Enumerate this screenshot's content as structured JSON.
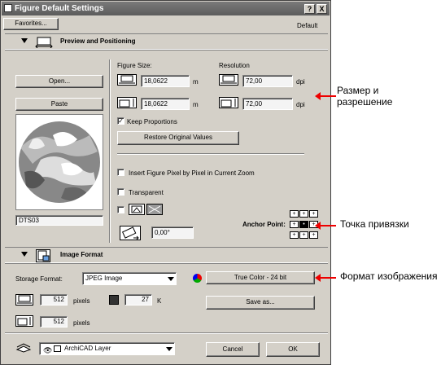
{
  "window": {
    "title": "Figure Default Settings",
    "help_label": "?",
    "close_label": "X"
  },
  "toolbar": {
    "favorites_label": "Favorites...",
    "default_label": "Default"
  },
  "preview_section": {
    "title": "Preview and Positioning"
  },
  "buttons": {
    "open_label": "Open...",
    "paste_label": "Paste",
    "restore_label": "Restore Original Values"
  },
  "filename": "DTS03",
  "size": {
    "label": "Figure Size:",
    "width": "18,0622",
    "height": "18,0622",
    "unit": "m"
  },
  "resolution": {
    "label": "Resolution",
    "horizontal": "72,00",
    "vertical": "72,00",
    "unit": "dpi"
  },
  "options": {
    "keep_proportions": "Keep Proportions",
    "keep_proportions_checked": true,
    "insert_pixel": "Insert Figure Pixel by Pixel in Current Zoom",
    "insert_pixel_checked": false,
    "transparent": "Transparent",
    "transparent_checked": false,
    "mirror_checked": false
  },
  "rotation": {
    "value": "0,00°"
  },
  "anchor": {
    "label": "Anchor Point:"
  },
  "image_format_section": {
    "title": "Image Format"
  },
  "format": {
    "storage_label": "Storage Format:",
    "storage_value": "JPEG Image",
    "color_depth": "True Color - 24 bit",
    "save_as_label": "Save as...",
    "width_px": "512",
    "height_px": "512",
    "pixels_unit": "pixels",
    "file_size": "27",
    "file_size_unit": "K"
  },
  "bottom": {
    "layer_value": "ArchiCAD Layer",
    "cancel_label": "Cancel",
    "ok_label": "OK"
  },
  "annotations": {
    "size_resolution": "Размер и\nразрешение",
    "anchor_point": "Точка привязки",
    "image_format": "Формат изображения"
  }
}
